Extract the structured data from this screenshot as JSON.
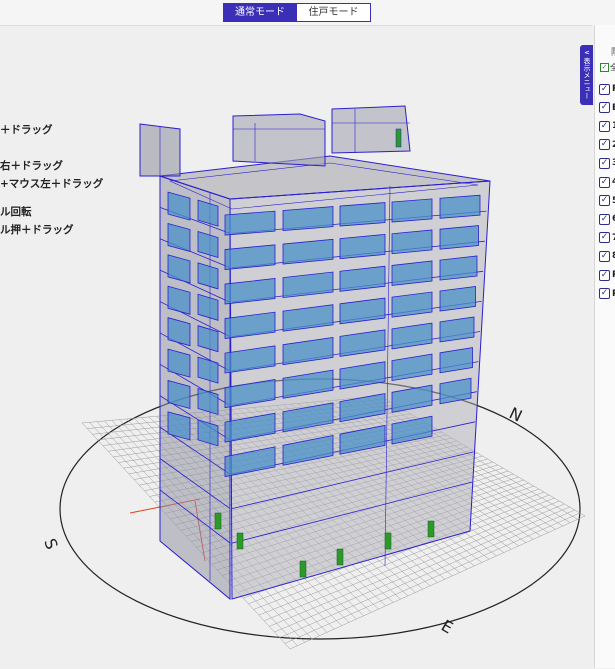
{
  "modes": {
    "normal": "通常モード",
    "dwelling": "住戸モード"
  },
  "help_lines": [
    "＋ドラッグ",
    "右＋ドラッグ",
    "+マウス左＋ドラッグ",
    "ル回転",
    "ル押＋ドラッグ"
  ],
  "side_panel": {
    "tab_label": "∨ 表示メニュー",
    "header": "階",
    "all_label": "全",
    "floors": [
      "R",
      "B",
      "1",
      "2",
      "3",
      "4",
      "5",
      "6",
      "7",
      "8",
      "P",
      "P"
    ]
  },
  "compass": {
    "north": "N",
    "south": "S",
    "east": "E"
  },
  "colors": {
    "accent": "#3b2fb8",
    "building_edge": "#2a1fd0",
    "window": "#4a90c8",
    "door": "#2a9a2a"
  }
}
